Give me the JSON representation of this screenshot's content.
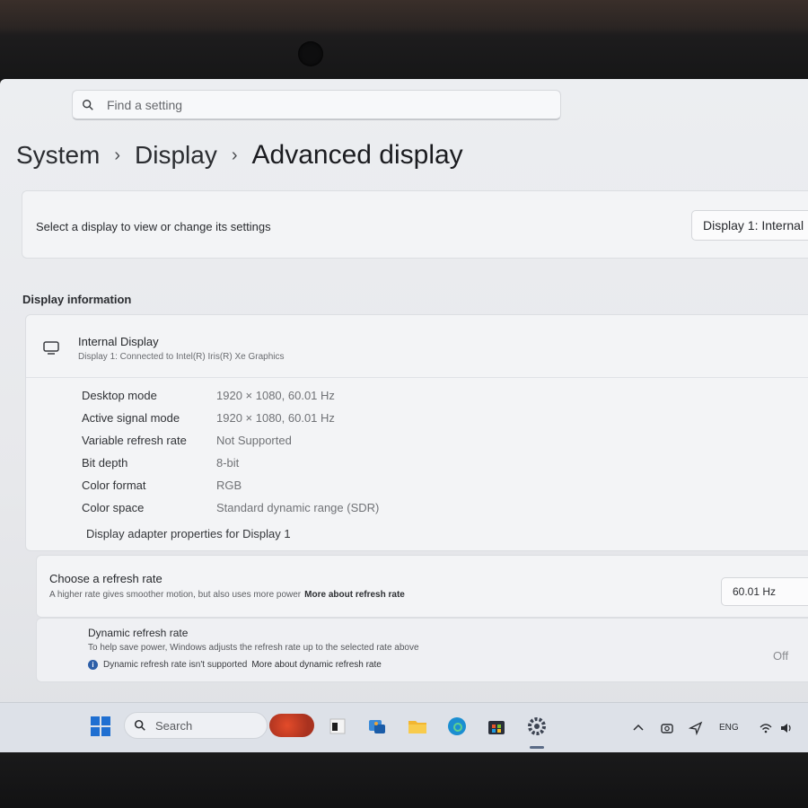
{
  "search": {
    "placeholder": "Find a setting"
  },
  "breadcrumb": {
    "level1": "System",
    "level2": "Display",
    "current": "Advanced display",
    "separator": "›"
  },
  "display_select": {
    "label": "Select a display to view or change its settings",
    "selected": "Display 1: Internal"
  },
  "display_info": {
    "section_title": "Display information",
    "display_name": "Internal Display",
    "display_sub": "Display 1: Connected to Intel(R) Iris(R) Xe Graphics",
    "properties": [
      {
        "key": "Desktop mode",
        "value": "1920 × 1080, 60.01 Hz"
      },
      {
        "key": "Active signal mode",
        "value": "1920 × 1080, 60.01 Hz"
      },
      {
        "key": "Variable refresh rate",
        "value": "Not Supported"
      },
      {
        "key": "Bit depth",
        "value": "8-bit"
      },
      {
        "key": "Color format",
        "value": "RGB"
      },
      {
        "key": "Color space",
        "value": "Standard dynamic range (SDR)"
      }
    ],
    "adapter_link": "Display adapter properties for Display 1"
  },
  "refresh_rate": {
    "title": "Choose a refresh rate",
    "description": "A higher rate gives smoother motion, but also uses more power",
    "more_link": "More about refresh rate",
    "selected": "60.01 Hz"
  },
  "dynamic_refresh": {
    "title": "Dynamic refresh rate",
    "description": "To help save power, Windows adjusts the refresh rate up to the selected rate above",
    "note": "Dynamic refresh rate isn't supported",
    "more_link": "More about dynamic refresh rate",
    "state": "Off"
  },
  "taskbar": {
    "search_label": "Search",
    "language": "ENG",
    "pinned_icons": [
      "start-icon",
      "search-icon",
      "widget-icon",
      "terminal-icon",
      "photos-icon",
      "file-explorer-icon",
      "edge-icon",
      "store-icon",
      "settings-icon"
    ],
    "tray_icons": [
      "chevron-up-icon",
      "camera-icon",
      "location-icon",
      "wifi-icon",
      "volume-icon"
    ]
  },
  "colors": {
    "accent": "#2d5fa8",
    "screen_bg": "#eceef1",
    "taskbar_bg": "#dde1e8"
  }
}
